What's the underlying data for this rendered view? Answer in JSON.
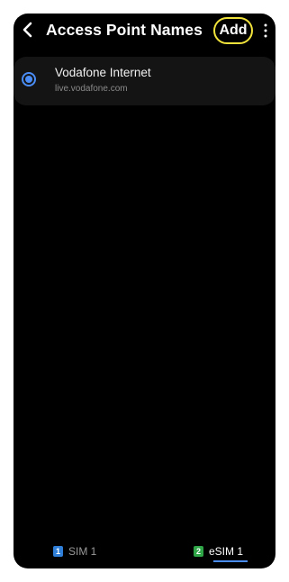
{
  "header": {
    "title": "Access Point Names",
    "add_label": "Add",
    "back_icon": "chevron-left-icon",
    "more_icon": "more-vertical-icon"
  },
  "apn_list": [
    {
      "name": "Vodafone Internet",
      "apn": "live.vodafone.com",
      "selected": true
    }
  ],
  "sim_tabs": [
    {
      "badge": "1",
      "label": "SIM 1",
      "badge_color": "#2f7fd8",
      "active": false
    },
    {
      "badge": "2",
      "label": "eSIM 1",
      "badge_color": "#2fa648",
      "active": true
    }
  ],
  "colors": {
    "background": "#000000",
    "accent": "#4a8df6",
    "highlight_ring": "#f1e33b",
    "list_item_bg": "#141414"
  }
}
